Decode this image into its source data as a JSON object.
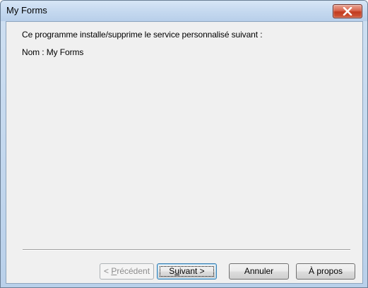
{
  "window": {
    "title": "My Forms"
  },
  "content": {
    "intro": "Ce programme installe/supprime le service personnalisé suivant :",
    "name_line": "Nom : My Forms"
  },
  "buttons": {
    "previous": {
      "before": "< ",
      "mnemonic": "P",
      "after": "récédent",
      "enabled": false
    },
    "next": {
      "before": "S",
      "mnemonic": "u",
      "after": "ivant >",
      "enabled": true,
      "default": true
    },
    "cancel": {
      "label": "Annuler"
    },
    "about": {
      "label": "À propos"
    }
  },
  "icons": {
    "close": "close-icon"
  }
}
